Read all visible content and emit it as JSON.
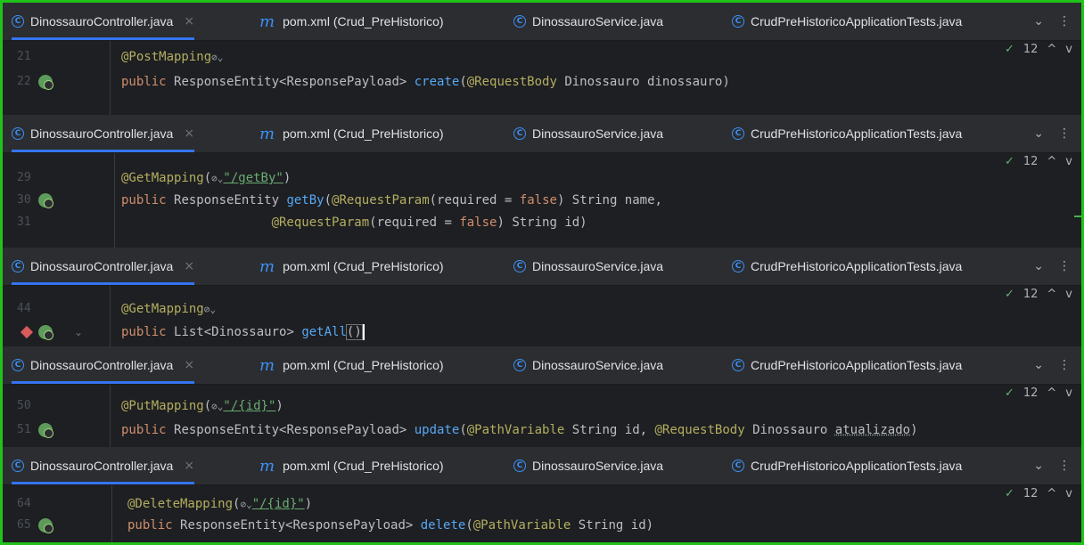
{
  "tabs": [
    {
      "name": "DinossauroController.java",
      "icon": "class-icon",
      "closable": true
    },
    {
      "name": "pom.xml (Crud_PreHistorico)",
      "icon": "maven-icon",
      "closable": false
    },
    {
      "name": "DinossauroService.java",
      "icon": "class-icon",
      "closable": false
    },
    {
      "name": "CrudPreHistoricoApplicationTests.java",
      "icon": "class-icon",
      "closable": false
    }
  ],
  "tab_close_glyph": "×",
  "tabbar_more": "⌄",
  "tabbar_menu": "⋮",
  "inspections": {
    "count": "12",
    "up": "^",
    "down": "v",
    "check": "✓"
  },
  "panes": [
    {
      "lines": [
        {
          "num": "21",
          "parts": [
            [
              "an",
              "@PostMapping"
            ],
            [
              "gl",
              "⊘⌄"
            ]
          ]
        },
        {
          "num": "22",
          "parts": [
            [
              "kw",
              "public "
            ],
            [
              "",
              "ResponseEntity<ResponsePayload> "
            ],
            [
              "fn",
              "create"
            ],
            [
              "",
              "("
            ],
            [
              "an",
              "@RequestBody "
            ],
            [
              "",
              "Dinossauro dinossauro)"
            ]
          ]
        }
      ]
    },
    {
      "lines": [
        {
          "num": "29",
          "parts": [
            [
              "an",
              "@GetMapping"
            ],
            [
              "",
              "("
            ],
            [
              "gl",
              "⊘⌄"
            ],
            [
              "str",
              "\"/getBy\""
            ],
            [
              "",
              ")"
            ]
          ]
        },
        {
          "num": "30",
          "parts": [
            [
              "kw",
              "public "
            ],
            [
              "",
              "ResponseEntity "
            ],
            [
              "fn",
              "getBy"
            ],
            [
              "",
              "("
            ],
            [
              "an",
              "@RequestParam"
            ],
            [
              "",
              "(required = "
            ],
            [
              "kw",
              "false"
            ],
            [
              "",
              ") String name,"
            ]
          ]
        },
        {
          "num": "31",
          "parts": [
            [
              "",
              "                    "
            ],
            [
              "an",
              "@RequestParam"
            ],
            [
              "",
              "(required = "
            ],
            [
              "kw",
              "false"
            ],
            [
              "",
              ") String id)"
            ]
          ]
        }
      ]
    },
    {
      "lines": [
        {
          "num": "44",
          "parts": [
            [
              "an",
              "@GetMapping"
            ],
            [
              "gl",
              "⊘⌄"
            ]
          ]
        },
        {
          "num": "",
          "parts": [
            [
              "kw",
              "public "
            ],
            [
              "",
              "List<Dinossauro> "
            ],
            [
              "fn",
              "getAll"
            ],
            [
              "brk",
              "()"
            ]
          ]
        }
      ]
    },
    {
      "lines": [
        {
          "num": "50",
          "parts": [
            [
              "an",
              "@PutMapping"
            ],
            [
              "",
              "("
            ],
            [
              "gl",
              "⊘⌄"
            ],
            [
              "str",
              "\"/{id}\""
            ],
            [
              "",
              ")"
            ]
          ]
        },
        {
          "num": "51",
          "parts": [
            [
              "kw",
              "public "
            ],
            [
              "",
              "ResponseEntity<ResponsePayload> "
            ],
            [
              "fn",
              "update"
            ],
            [
              "",
              "("
            ],
            [
              "an",
              "@PathVariable "
            ],
            [
              "",
              "String id, "
            ],
            [
              "an",
              "@RequestBody "
            ],
            [
              "",
              "Dinossauro "
            ],
            [
              "und",
              "atualizado"
            ],
            [
              "",
              ")"
            ]
          ]
        }
      ]
    },
    {
      "lines": [
        {
          "num": "64",
          "parts": [
            [
              "an",
              "@DeleteMapping"
            ],
            [
              "",
              "("
            ],
            [
              "gl",
              "⊘⌄"
            ],
            [
              "str",
              "\"/{id}\""
            ],
            [
              "",
              ")"
            ]
          ]
        },
        {
          "num": "65",
          "parts": [
            [
              "kw",
              "public "
            ],
            [
              "",
              "ResponseEntity<ResponsePayload> "
            ],
            [
              "fn",
              "delete"
            ],
            [
              "",
              "("
            ],
            [
              "an",
              "@PathVariable "
            ],
            [
              "",
              "String id)"
            ]
          ]
        }
      ]
    }
  ],
  "colors": {
    "frame": "#20c31a",
    "editor_bg": "#1e1f22",
    "tabbar_bg": "#2b2d30",
    "annotation": "#b3ae60",
    "keyword": "#cf8e6d",
    "function": "#56a8f5",
    "string": "#6aab73"
  }
}
